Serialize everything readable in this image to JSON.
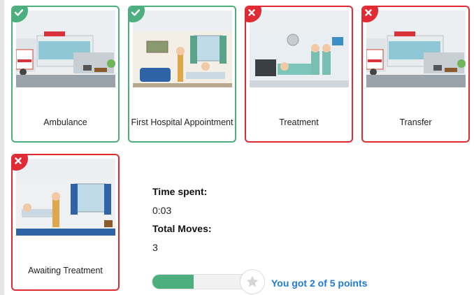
{
  "cards": [
    {
      "label": "Ambulance",
      "status": "correct",
      "icon": "check-icon"
    },
    {
      "label": "First Hospital Appointment",
      "status": "correct",
      "icon": "check-icon"
    },
    {
      "label": "Treatment",
      "status": "incorrect",
      "icon": "x-icon"
    },
    {
      "label": "Transfer",
      "status": "incorrect",
      "icon": "x-icon"
    },
    {
      "label": "Awaiting Treatment",
      "status": "incorrect",
      "icon": "x-icon"
    }
  ],
  "results": {
    "time_label": "Time spent:",
    "time_value": "0:03",
    "moves_label": "Total Moves:",
    "moves_value": "3",
    "score_text": "You got 2 of 5 points",
    "score_fraction": 0.4,
    "star_icon": "star-icon"
  },
  "colors": {
    "correct": "#4caf7d",
    "incorrect": "#e02b34",
    "score_text": "#1f7ad6"
  }
}
